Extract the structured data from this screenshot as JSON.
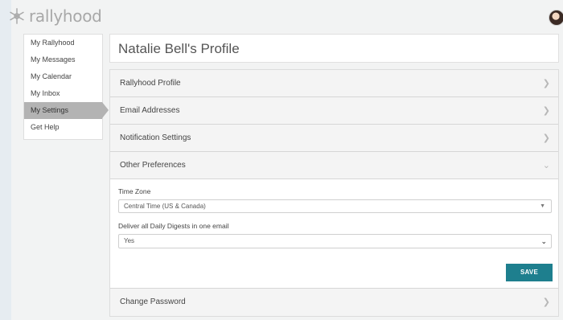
{
  "header": {
    "logo_text": "rallyhood"
  },
  "sidebar": {
    "items": [
      {
        "label": "My Rallyhood"
      },
      {
        "label": "My Messages"
      },
      {
        "label": "My Calendar"
      },
      {
        "label": "My Inbox"
      },
      {
        "label": "My Settings"
      },
      {
        "label": "Get Help"
      }
    ],
    "active_item": "My Settings"
  },
  "profile": {
    "title": "Natalie Bell's Profile"
  },
  "accordion": {
    "sections": [
      {
        "label": "Rallyhood Profile"
      },
      {
        "label": "Email Addresses"
      },
      {
        "label": "Notification Settings"
      },
      {
        "label": "Other Preferences"
      },
      {
        "label": "Change Password"
      }
    ]
  },
  "preferences": {
    "time_zone_label": "Time Zone",
    "time_zone_value": "Central Time (US & Canada)",
    "digest_label": "Deliver all Daily Digests in one email",
    "digest_value": "Yes",
    "save_label": "SAVE"
  },
  "colors": {
    "accent": "#1e7f8e",
    "active_nav": "#b3b3b3"
  },
  "icons": {
    "logo": "snowflake-logo-icon",
    "chevron_right": "chevron-right-icon",
    "chevron_down": "chevron-down-icon"
  }
}
